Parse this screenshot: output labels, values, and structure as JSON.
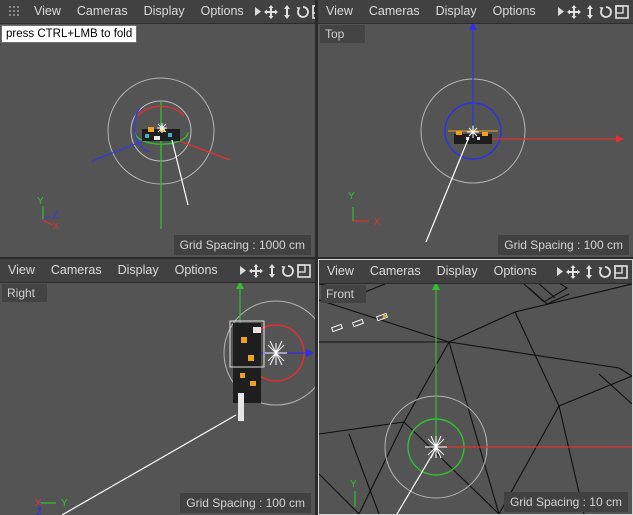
{
  "menu": [
    "View",
    "Cameras",
    "Display",
    "Options"
  ],
  "tooltip": "press CTRL+LMB to fold",
  "viewports": [
    {
      "id": "perspective",
      "label": "",
      "grid": "Grid Spacing : 1000 cm"
    },
    {
      "id": "top",
      "label": "Top",
      "grid": "Grid Spacing : 100 cm"
    },
    {
      "id": "right",
      "label": "Right",
      "grid": "Grid Spacing : 100 cm"
    },
    {
      "id": "front",
      "label": "Front",
      "grid": "Grid Spacing : 10 cm"
    }
  ],
  "axis_labels": {
    "x": "X",
    "y": "Y",
    "z": "Z"
  },
  "colors": {
    "x_axis": "#e83232",
    "y_axis": "#33cc33",
    "z_axis": "#2f2fe8",
    "accent": "#f0a020"
  },
  "icons": [
    "move-icon",
    "pan-icon",
    "rotate-icon",
    "maximize-icon"
  ]
}
